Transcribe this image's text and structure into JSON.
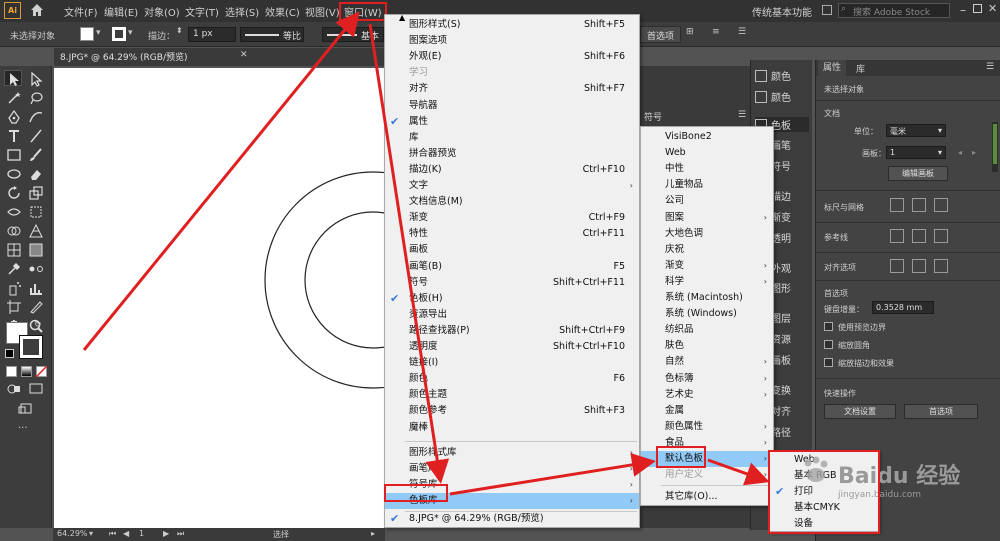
{
  "menubar": {
    "logo": "Ai",
    "items": [
      "文件(F)",
      "编辑(E)",
      "对象(O)",
      "文字(T)",
      "选择(S)",
      "效果(C)",
      "视图(V)",
      "窗口(W)"
    ],
    "workspace": "传统基本功能",
    "search_placeholder": "搜索 Adobe Stock"
  },
  "controlbar": {
    "selection_label": "未选择对象",
    "stroke_label": "描边：",
    "stroke_value": "1 px",
    "profile_label": "等比",
    "basic_label": "基本",
    "pref_button": "首选项"
  },
  "document": {
    "tab_title": "8.JPG* @ 64.29% (RGB/预览)",
    "zoom": "64.29%",
    "page": "1",
    "status": "选择"
  },
  "window_menu": {
    "items": [
      {
        "label": "图形样式(S)",
        "shortcut": "Shift+F5"
      },
      {
        "label": "图案选项"
      },
      {
        "label": "外观(E)",
        "shortcut": "Shift+F6"
      },
      {
        "label": "学习",
        "disabled": true
      },
      {
        "label": "对齐",
        "shortcut": "Shift+F7"
      },
      {
        "label": "导航器"
      },
      {
        "label": "属性",
        "checked": true
      },
      {
        "label": "库"
      },
      {
        "label": "拼合器预览"
      },
      {
        "label": "描边(K)",
        "shortcut": "Ctrl+F10"
      },
      {
        "label": "文字",
        "submenu": true
      },
      {
        "label": "文档信息(M)"
      },
      {
        "label": "渐变",
        "shortcut": "Ctrl+F9"
      },
      {
        "label": "特性",
        "shortcut": "Ctrl+F11"
      },
      {
        "label": "画板"
      },
      {
        "label": "画笔(B)",
        "shortcut": "F5"
      },
      {
        "label": "符号",
        "shortcut": "Shift+Ctrl+F11"
      },
      {
        "label": "色板(H)",
        "checked": true
      },
      {
        "label": "资源导出"
      },
      {
        "label": "路径查找器(P)",
        "shortcut": "Shift+Ctrl+F9"
      },
      {
        "label": "透明度",
        "shortcut": "Shift+Ctrl+F10"
      },
      {
        "label": "链接(I)"
      },
      {
        "label": "颜色",
        "shortcut": "F6"
      },
      {
        "label": "颜色主题"
      },
      {
        "label": "颜色参考",
        "shortcut": "Shift+F3"
      },
      {
        "label": "魔棒"
      }
    ],
    "libraries": [
      {
        "label": "图形样式库",
        "submenu": true
      },
      {
        "label": "画笔库",
        "submenu": true
      },
      {
        "label": "符号库",
        "submenu": true
      },
      {
        "label": "色板库",
        "submenu": true,
        "selected": true
      }
    ],
    "open_doc": "8.JPG* @ 64.29% (RGB/预览)"
  },
  "swatch_menu": {
    "items": [
      {
        "label": "VisiBone2"
      },
      {
        "label": "Web"
      },
      {
        "label": "中性"
      },
      {
        "label": "儿童物品"
      },
      {
        "label": "公司"
      },
      {
        "label": "图案",
        "submenu": true
      },
      {
        "label": "大地色调"
      },
      {
        "label": "庆祝"
      },
      {
        "label": "渐变",
        "submenu": true
      },
      {
        "label": "科学",
        "submenu": true
      },
      {
        "label": "系统 (Macintosh)"
      },
      {
        "label": "系统 (Windows)"
      },
      {
        "label": "纺织品"
      },
      {
        "label": "肤色"
      },
      {
        "label": "自然",
        "submenu": true
      },
      {
        "label": "色标簿",
        "submenu": true
      },
      {
        "label": "艺术史",
        "submenu": true
      },
      {
        "label": "金属"
      },
      {
        "label": "颜色属性",
        "submenu": true
      },
      {
        "label": "食品",
        "submenu": true
      },
      {
        "label": "默认色板",
        "submenu": true,
        "selected": true
      },
      {
        "label": "用户定义",
        "submenu": true,
        "disabled": true
      }
    ],
    "other": "其它库(O)..."
  },
  "default_menu": {
    "items": [
      {
        "label": "Web"
      },
      {
        "label": "基本 RGB"
      },
      {
        "label": "打印",
        "checked": true
      },
      {
        "label": "基本CMYK"
      },
      {
        "label": "设备"
      }
    ]
  },
  "panel_strip": {
    "items": [
      "颜色",
      "颜色",
      "色板",
      "画笔",
      "符号",
      "描边",
      "渐变",
      "透明",
      "外观",
      "图形",
      "图层",
      "资源",
      "画板",
      "变换",
      "对齐",
      "路径"
    ]
  },
  "mid_panel": {
    "tab_label": "符号"
  },
  "properties": {
    "tabs": [
      "属性",
      "库"
    ],
    "no_selection": "未选择对象",
    "document_heading": "文档",
    "unit_label": "单位：",
    "unit_value": "毫米",
    "artboard_label": "画板：",
    "artboard_value": "1",
    "edit_artboards": "编辑画板",
    "rulers_heading": "标尺与网格",
    "guides_heading": "参考线",
    "snap_heading": "对齐选项",
    "prefs_heading": "首选项",
    "key_increment_label": "键盘增量：",
    "key_increment_value": "0.3528 mm",
    "opt_preview_bounds": "使用预览边界",
    "opt_scale_corners": "缩放圆角",
    "opt_scale_strokes": "缩放描边和效果",
    "quick_actions": "快速操作",
    "doc_setup": "文档设置",
    "preferences": "首选项"
  },
  "watermark": {
    "text": "Baidu 经验",
    "subtext": "jingyan.baidu.com"
  },
  "colors": {
    "annotation_red": "#e02020",
    "menu_highlight": "#91c9f7",
    "check_blue": "#3a7ad8",
    "ui_dark": "#323232",
    "panel_bg": "#434343"
  }
}
